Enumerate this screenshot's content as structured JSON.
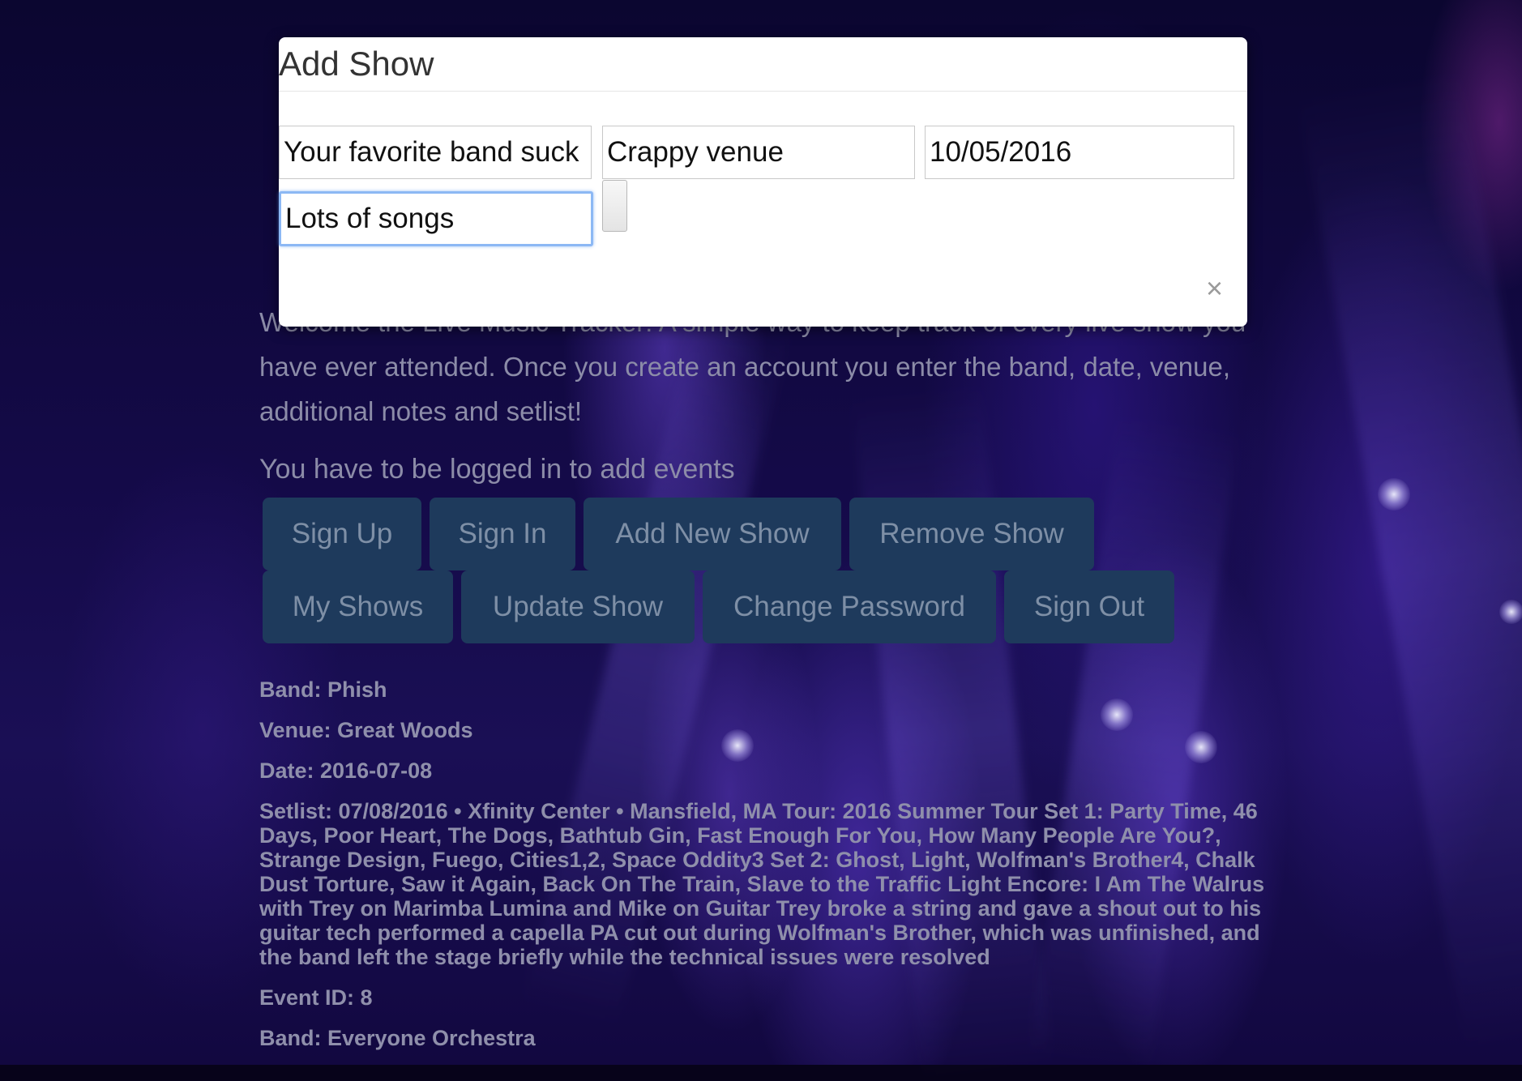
{
  "intro": {
    "text": "Welcome the Live Music Tracker! A simple way to keep track of every live show you have ever attended. Once you create an account you enter the band, date, venue, additional notes and setlist!"
  },
  "login_note": "You have to be logged in to add events",
  "buttons": {
    "row1": [
      "Sign Up",
      "Sign In",
      "Add New Show",
      "Remove Show"
    ],
    "row2": [
      "My Shows",
      "Update Show",
      "Change Password",
      "Sign Out"
    ]
  },
  "events": [
    {
      "band": "Band: Phish",
      "venue": "Venue: Great Woods",
      "date": "Date: 2016-07-08",
      "setlist": "Setlist: 07/08/2016 • Xfinity Center • Mansfield, MA Tour: 2016 Summer Tour Set 1: Party Time, 46 Days, Poor Heart, The Dogs, Bathtub Gin, Fast Enough For You, How Many People Are You?, Strange Design, Fuego, Cities1,2, Space Oddity3 Set 2: Ghost, Light, Wolfman's Brother4, Chalk Dust Torture, Saw it Again, Back On The Train, Slave to the Traffic Light Encore: I Am The Walrus with Trey on Marimba Lumina and Mike on Guitar Trey broke a string and gave a shout out to his guitar tech performed a capella PA cut out during Wolfman's Brother, which was unfinished, and the band left the stage briefly while the technical issues were resolved",
      "event_id": "Event ID: 8"
    },
    {
      "band": "Band: Everyone Orchestra"
    }
  ],
  "modal": {
    "title": "Add Show",
    "band_value": "Your favorite band suck",
    "venue_value": "Crappy venue",
    "date_value": "10/05/2016",
    "notes_value": "Lots of songs",
    "close_glyph": "×"
  }
}
